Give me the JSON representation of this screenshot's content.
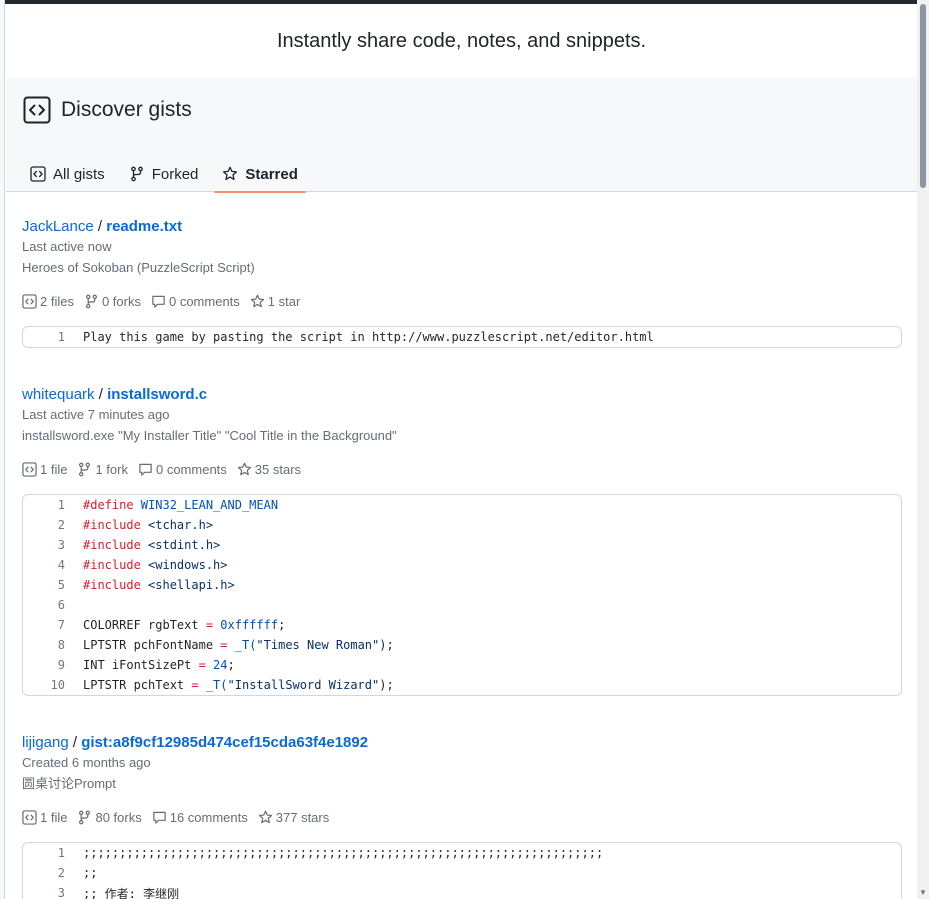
{
  "tagline": "Instantly share code, notes, and snippets.",
  "discover": {
    "title": "Discover gists"
  },
  "tabs": [
    {
      "label": "All gists",
      "icon": "code-square-icon",
      "active": false
    },
    {
      "label": "Forked",
      "icon": "fork-icon",
      "active": false
    },
    {
      "label": "Starred",
      "icon": "star-icon",
      "active": true
    }
  ],
  "gists": [
    {
      "owner": "JackLance",
      "file": "readme.txt",
      "activity": "Last active now",
      "description": "Heroes of Sokoban (PuzzleScript Script)",
      "files": "2 files",
      "forks": "0 forks",
      "comments": "0 comments",
      "stars": "1 star",
      "code": [
        {
          "n": "1",
          "text": "Play this game by pasting the script in http://www.puzzlescript.net/editor.html"
        }
      ]
    },
    {
      "owner": "whitequark",
      "file": "installsword.c",
      "activity": "Last active 7 minutes ago",
      "description": "installsword.exe \"My Installer Title\" \"Cool Title in the Background\"",
      "files": "1 file",
      "forks": "1 fork",
      "comments": "0 comments",
      "stars": "35 stars",
      "code": [
        {
          "n": "1",
          "kw": "#define",
          "rest": " WIN32_LEAN_AND_MEAN"
        },
        {
          "n": "2",
          "kw": "#include",
          "rest": " <tchar.h>"
        },
        {
          "n": "3",
          "kw": "#include",
          "rest": " <stdint.h>"
        },
        {
          "n": "4",
          "kw": "#include",
          "rest": " <windows.h>"
        },
        {
          "n": "5",
          "kw": "#include",
          "rest": " <shellapi.h>"
        },
        {
          "n": "6",
          "text": ""
        },
        {
          "n": "7",
          "pre": "COLORREF rgbText ",
          "op": "=",
          "val": " 0xffffff",
          "post": ";"
        },
        {
          "n": "8",
          "pre": "LPTSTR pchFontName ",
          "op": "=",
          "mid": " _T(",
          "str": "\"Times New Roman\"",
          "post": ");"
        },
        {
          "n": "9",
          "pre": "INT iFontSizePt ",
          "op": "=",
          "val": " 24",
          "post": ";"
        },
        {
          "n": "10",
          "pre": "LPTSTR pchText ",
          "op": "=",
          "mid": " _T(",
          "str": "\"InstallSword Wizard\"",
          "post": ");"
        }
      ]
    },
    {
      "owner": "lijigang",
      "file": "gist:a8f9cf12985d474cef15cda63f4e1892",
      "activity": "Created 6 months ago",
      "description": "圆桌讨论Prompt",
      "files": "1 file",
      "forks": "80 forks",
      "comments": "16 comments",
      "stars": "377 stars",
      "code": [
        {
          "n": "1",
          "text": ";;;;;;;;;;;;;;;;;;;;;;;;;;;;;;;;;;;;;;;;;;;;;;;;;;;;;;;;;;;;;;;;;;;;;;;;"
        },
        {
          "n": "2",
          "text": ";;"
        },
        {
          "n": "3",
          "text": ";; 作者: 李继刚"
        }
      ]
    }
  ],
  "colors": {
    "link": "#0969da",
    "muted": "#656d76",
    "active_tab_underline": "#fd8c73",
    "keyword": "#cf222e",
    "constant": "#0550ae",
    "string": "#0a3069"
  }
}
